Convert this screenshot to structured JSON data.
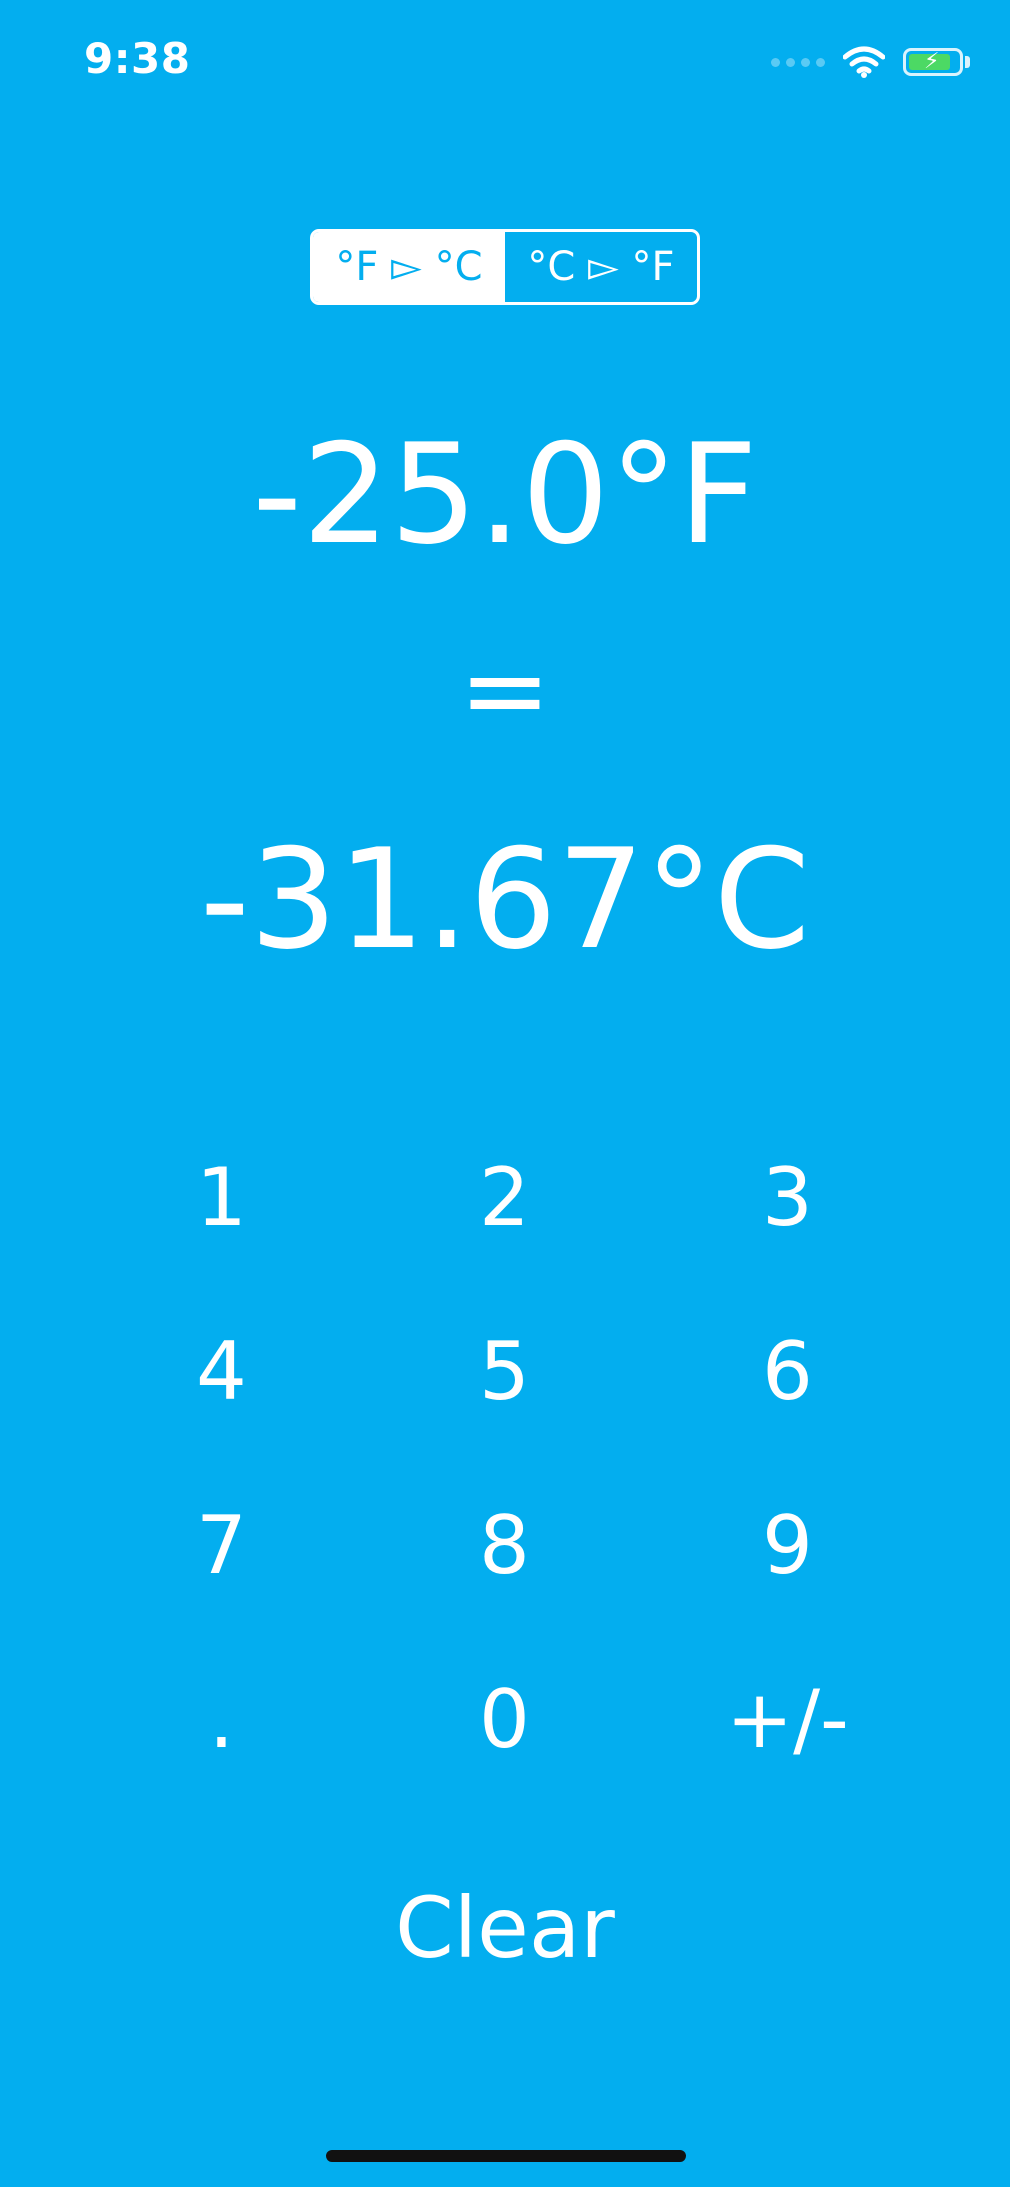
{
  "status_bar": {
    "time": "9:38",
    "icons": [
      "signal-dots-icon",
      "wifi-icon",
      "battery-charging-icon"
    ]
  },
  "mode_toggle": {
    "options": [
      "°F ▻ °C",
      "°C ▻ °F"
    ],
    "selected_index": 0
  },
  "input_value": "-25.0°F",
  "equals_sign": "=",
  "output_value": "-31.67°C",
  "keypad": {
    "keys": [
      "1",
      "2",
      "3",
      "4",
      "5",
      "6",
      "7",
      "8",
      "9",
      ".",
      "0",
      "+/-"
    ]
  },
  "clear_label": "Clear",
  "colors": {
    "background": "#03AEEF",
    "foreground": "#FFFFFF",
    "battery": "#4CD964"
  }
}
